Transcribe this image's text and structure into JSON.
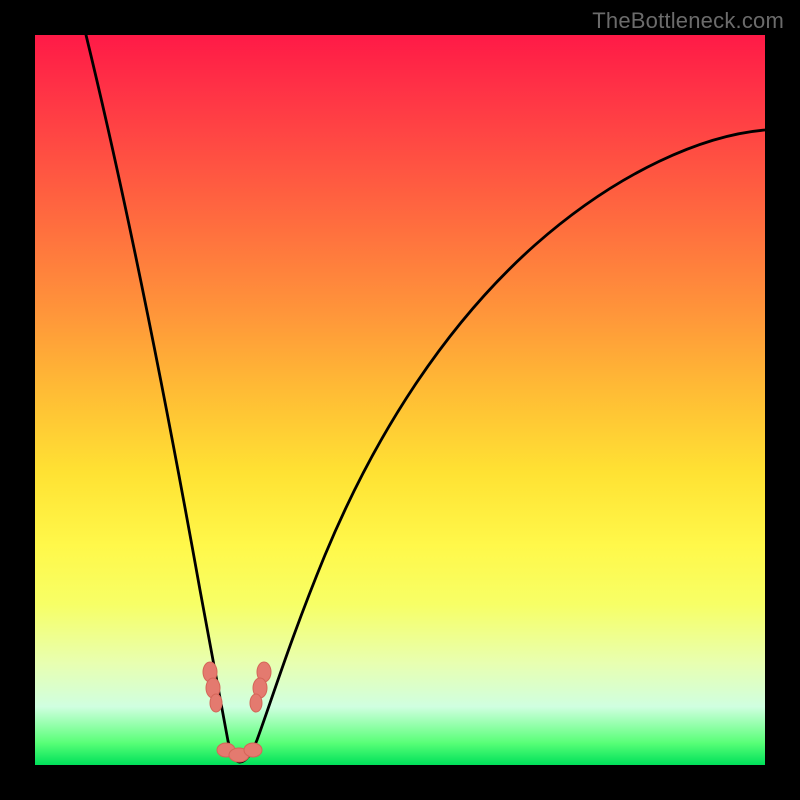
{
  "watermark": "TheBottleneck.com",
  "chart_data": {
    "type": "line",
    "title": "",
    "xlabel": "",
    "ylabel": "",
    "xlim": [
      0,
      100
    ],
    "ylim": [
      0,
      100
    ],
    "grid": false,
    "legend": false,
    "background_gradient": {
      "top": "#ff1a47",
      "mid": "#fff84a",
      "bottom": "#00e05a"
    },
    "series": [
      {
        "name": "bottleneck-curve",
        "color": "#000000",
        "x": [
          7,
          10,
          13,
          16,
          19,
          21,
          23,
          24.5,
          26,
          27,
          28,
          30,
          32,
          34,
          37,
          41,
          46,
          52,
          59,
          67,
          76,
          86,
          96,
          100
        ],
        "y": [
          100,
          86,
          72,
          58,
          44,
          32,
          21,
          12,
          6,
          2,
          0.5,
          1,
          4,
          11,
          22,
          35,
          47,
          57,
          66,
          73,
          79,
          83,
          86,
          87
        ]
      }
    ],
    "markers": [
      {
        "name": "marker-left-pair",
        "x": 23.5,
        "y": 8
      },
      {
        "name": "marker-right-pair",
        "x": 31.0,
        "y": 8
      },
      {
        "name": "marker-bottom-cluster",
        "x": 27.0,
        "y": 1
      }
    ],
    "notch_x": 27.5
  }
}
